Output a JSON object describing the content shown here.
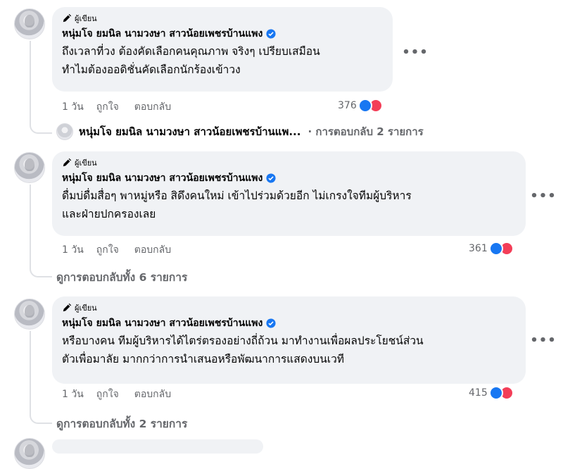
{
  "comments": [
    {
      "author_badge": "ผู้เขียน",
      "name": "หนุ่มโจ ยมนิล นามวงษา สาวน้อยเพชรบ้านแพง",
      "line1": "ถึงเวลาที่วง ต้องคัดเลือกคนคุณภาพ จริงๆ เปรียบเสมือน",
      "line2": "ทำไมต้องออดิชั่นคัดเลือกนักร้องเข้าวง",
      "time": "1 วัน",
      "like": "ถูกใจ",
      "reply": "ตอบกลับ",
      "reaction_count": "376",
      "reply_preview_name": "หนุ่มโจ ยมนิล นามวงษา สาวน้อยเพชรบ้านแพ...",
      "reply_preview_count": "· การตอบกลับ 2 รายการ"
    },
    {
      "author_badge": "ผู้เขียน",
      "name": "หนุ่มโจ ยมนิล นามวงษา สาวน้อยเพชรบ้านแพง",
      "line1": "ดื่มบ่ดื่มสื่อๆ พาหมู่หรือ สิดึงคนใหม่ เข้าไปร่วมด้วยอีก ไม่เกรงใจทีมผู้บริหาร",
      "line2": "และฝ่ายปกครองเลย",
      "time": "1 วัน",
      "like": "ถูกใจ",
      "reply": "ตอบกลับ",
      "reaction_count": "361",
      "view_replies": "ดูการตอบกลับทั้ง 6 รายการ"
    },
    {
      "author_badge": "ผู้เขียน",
      "name": "หนุ่มโจ ยมนิล นามวงษา สาวน้อยเพชรบ้านแพง",
      "line1": "หรือบางคน ทีมผู้บริหารได้ไตร่ตรองอย่างถี่ถ้วน มาทำงานเพื่อผลประโยชน์ส่วน",
      "line2": "ตัวเพื่อมาลัย มากกว่าการนำเสนอหรือพัฒนาการแสดงบนเวที",
      "time": "1 วัน",
      "like": "ถูกใจ",
      "reply": "ตอบกลับ",
      "reaction_count": "415",
      "view_replies": "ดูการตอบกลับทั้ง 2 รายการ"
    }
  ],
  "icons": {
    "author": "pencil-icon",
    "verified": "verified-badge-icon",
    "more": "more-options-icon",
    "like": "like-reaction-icon",
    "love": "love-reaction-icon"
  },
  "colors": {
    "bubble": "#f0f2f5",
    "secondary_text": "#65676b",
    "verified_blue": "#1877f2",
    "love_red": "#f33e58"
  }
}
